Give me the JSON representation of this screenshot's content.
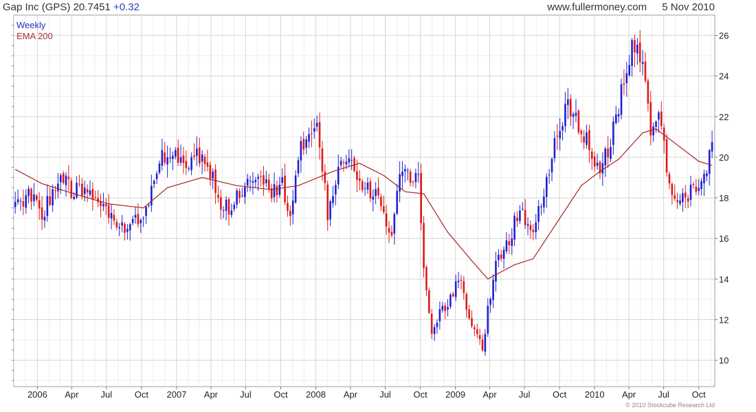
{
  "header": {
    "title": "Gap Inc (GPS)",
    "price": "20.7451",
    "change": "+0.32",
    "site": "www.fullermoney.com",
    "date": "5 Nov 2010"
  },
  "footer": {
    "copyright": "© 2010 Stockcube Research Ltd"
  },
  "colors": {
    "up": "#1f1fd0",
    "down": "#e01818",
    "ema": "#a82020",
    "grid": "#d4d4d4"
  },
  "chart_data": {
    "type": "candlestick",
    "frequency": "Weekly",
    "legend": [
      "Weekly",
      "EMA 200"
    ],
    "x_tick_labels": [
      "2006",
      "Apr",
      "Jul",
      "Oct",
      "2007",
      "Apr",
      "Jul",
      "Oct",
      "2008",
      "Apr",
      "Jul",
      "Oct",
      "2009",
      "Apr",
      "Jul",
      "Oct",
      "2010",
      "Apr",
      "Jul",
      "Oct"
    ],
    "x_ticks": [
      "2006-01-01",
      "2006-04-01",
      "2006-07-01",
      "2006-10-01",
      "2007-01-01",
      "2007-04-01",
      "2007-07-01",
      "2007-10-01",
      "2008-01-01",
      "2008-04-01",
      "2008-07-01",
      "2008-10-01",
      "2009-01-01",
      "2009-04-01",
      "2009-07-01",
      "2009-10-01",
      "2010-01-01",
      "2010-04-01",
      "2010-07-01",
      "2010-10-01"
    ],
    "x_range": [
      "2005-10-31",
      "2010-11-12"
    ],
    "y_ticks": [
      10,
      12,
      14,
      16,
      18,
      20,
      22,
      24,
      26
    ],
    "ylim": [
      8.7,
      27.0
    ],
    "y_axis_side": "right",
    "grid": true,
    "legend_position": "top-left",
    "close_path": [
      [
        "2005-11-04",
        17.5
      ],
      [
        "2005-12-16",
        18.1
      ],
      [
        "2006-01-13",
        17.2
      ],
      [
        "2006-02-10",
        18.4
      ],
      [
        "2006-03-10",
        18.8
      ],
      [
        "2006-03-31",
        18.3
      ],
      [
        "2006-05-05",
        18.6
      ],
      [
        "2006-06-09",
        17.8
      ],
      [
        "2006-07-14",
        17.0
      ],
      [
        "2006-08-18",
        16.3
      ],
      [
        "2006-09-22",
        16.9
      ],
      [
        "2006-10-13",
        17.6
      ],
      [
        "2006-11-10",
        19.5
      ],
      [
        "2006-12-08",
        20.4
      ],
      [
        "2007-01-19",
        19.7
      ],
      [
        "2007-02-23",
        20.1
      ],
      [
        "2007-03-30",
        19.3
      ],
      [
        "2007-04-27",
        17.8
      ],
      [
        "2007-05-25",
        17.4
      ],
      [
        "2007-06-29",
        18.8
      ],
      [
        "2007-08-03",
        19.0
      ],
      [
        "2007-09-07",
        18.4
      ],
      [
        "2007-10-05",
        18.6
      ],
      [
        "2007-10-26",
        17.3
      ],
      [
        "2007-11-23",
        20.5
      ],
      [
        "2007-12-21",
        21.6
      ],
      [
        "2008-01-11",
        21.0
      ],
      [
        "2008-02-01",
        17.2
      ],
      [
        "2008-02-29",
        19.3
      ],
      [
        "2008-04-04",
        19.8
      ],
      [
        "2008-05-09",
        18.5
      ],
      [
        "2008-06-13",
        17.9
      ],
      [
        "2008-07-18",
        15.8
      ],
      [
        "2008-08-08",
        19.5
      ],
      [
        "2008-08-29",
        19.4
      ],
      [
        "2008-09-26",
        18.7
      ],
      [
        "2008-10-10",
        14.2
      ],
      [
        "2008-10-31",
        11.3
      ],
      [
        "2008-11-21",
        12.5
      ],
      [
        "2008-12-12",
        12.8
      ],
      [
        "2009-01-09",
        14.1
      ],
      [
        "2009-01-30",
        12.6
      ],
      [
        "2009-02-20",
        11.3
      ],
      [
        "2009-03-13",
        10.6
      ],
      [
        "2009-03-27",
        12.5
      ],
      [
        "2009-04-17",
        14.8
      ],
      [
        "2009-05-08",
        15.3
      ],
      [
        "2009-06-05",
        16.7
      ],
      [
        "2009-06-26",
        17.1
      ],
      [
        "2009-07-24",
        16.0
      ],
      [
        "2009-08-21",
        18.5
      ],
      [
        "2009-09-25",
        21.0
      ],
      [
        "2009-10-23",
        22.8
      ],
      [
        "2009-11-20",
        21.6
      ],
      [
        "2009-12-18",
        20.5
      ],
      [
        "2010-01-15",
        19.4
      ],
      [
        "2010-02-12",
        20.6
      ],
      [
        "2010-03-12",
        23.2
      ],
      [
        "2010-04-02",
        24.8
      ],
      [
        "2010-04-23",
        26.0
      ],
      [
        "2010-05-07",
        24.5
      ],
      [
        "2010-05-28",
        21.2
      ],
      [
        "2010-06-18",
        22.5
      ],
      [
        "2010-07-09",
        19.6
      ],
      [
        "2010-07-30",
        18.0
      ],
      [
        "2010-08-20",
        17.8
      ],
      [
        "2010-09-10",
        18.3
      ],
      [
        "2010-10-01",
        18.9
      ],
      [
        "2010-10-22",
        19.6
      ],
      [
        "2010-11-05",
        20.75
      ]
    ],
    "ema_200": [
      [
        "2005-11-04",
        19.4
      ],
      [
        "2006-01-13",
        18.7
      ],
      [
        "2006-04-07",
        18.2
      ],
      [
        "2006-07-07",
        17.7
      ],
      [
        "2006-10-06",
        17.5
      ],
      [
        "2006-12-08",
        18.5
      ],
      [
        "2007-03-09",
        19.0
      ],
      [
        "2007-06-08",
        18.6
      ],
      [
        "2007-09-07",
        18.4
      ],
      [
        "2007-11-16",
        18.6
      ],
      [
        "2008-02-15",
        19.3
      ],
      [
        "2008-04-25",
        19.7
      ],
      [
        "2008-06-27",
        19.1
      ],
      [
        "2008-08-22",
        18.3
      ],
      [
        "2008-10-10",
        18.2
      ],
      [
        "2008-12-12",
        16.3
      ],
      [
        "2009-02-13",
        14.9
      ],
      [
        "2009-03-27",
        14.0
      ],
      [
        "2009-06-05",
        14.7
      ],
      [
        "2009-07-24",
        15.0
      ],
      [
        "2009-09-25",
        16.8
      ],
      [
        "2009-11-27",
        18.6
      ],
      [
        "2010-01-15",
        19.3
      ],
      [
        "2010-03-05",
        19.9
      ],
      [
        "2010-05-07",
        21.2
      ],
      [
        "2010-06-11",
        21.4
      ],
      [
        "2010-08-06",
        20.6
      ],
      [
        "2010-10-01",
        19.8
      ],
      [
        "2010-11-05",
        19.6
      ]
    ]
  }
}
